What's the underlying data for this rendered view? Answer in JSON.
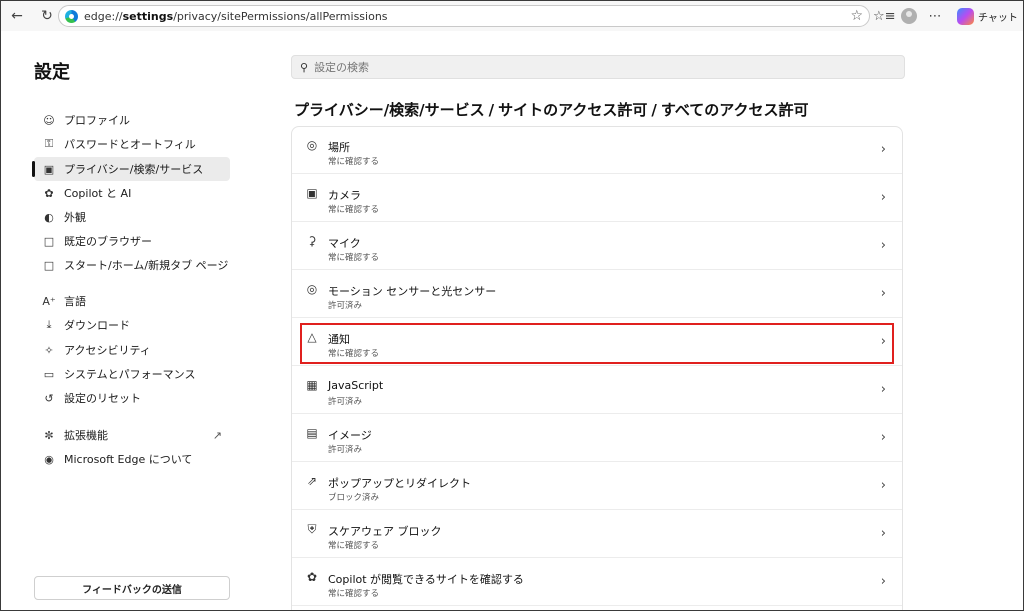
{
  "browser": {
    "url_prefix": "edge://",
    "url_host": "settings",
    "url_path": "/privacy/sitePermissions/allPermissions",
    "chat_label": "チャット"
  },
  "nav": {
    "title": "設定",
    "items": [
      {
        "label": "プロファイル",
        "icon": "profile-icon"
      },
      {
        "label": "パスワードとオートフィル",
        "icon": "key-icon"
      },
      {
        "label": "プライバシー/検索/サービス",
        "icon": "lock-icon"
      },
      {
        "label": "Copilot と AI",
        "icon": "copilot-icon"
      },
      {
        "label": "外観",
        "icon": "palette-icon"
      },
      {
        "label": "既定のブラウザー",
        "icon": "browser-icon"
      },
      {
        "label": "スタート/ホーム/新規タブ ページ",
        "icon": "home-icon"
      },
      {
        "label": "言語",
        "icon": "language-icon"
      },
      {
        "label": "ダウンロード",
        "icon": "download-icon"
      },
      {
        "label": "アクセシビリティ",
        "icon": "accessibility-icon"
      },
      {
        "label": "システムとパフォーマンス",
        "icon": "laptop-icon"
      },
      {
        "label": "設定のリセット",
        "icon": "reset-icon"
      },
      {
        "label": "拡張機能",
        "icon": "extensions-icon"
      },
      {
        "label": "Microsoft Edge について",
        "icon": "edge-icon"
      }
    ],
    "feedback_label": "フィードバックの送信"
  },
  "search": {
    "placeholder": "設定の検索"
  },
  "breadcrumb": {
    "parts": [
      "プライバシー/検索/サービス",
      "サイトのアクセス許可",
      "すべてのアクセス許可"
    ],
    "separator": "/"
  },
  "permissions": [
    {
      "title": "場所",
      "status": "常に確認する",
      "icon": "location-icon"
    },
    {
      "title": "カメラ",
      "status": "常に確認する",
      "icon": "camera-icon"
    },
    {
      "title": "マイク",
      "status": "常に確認する",
      "icon": "microphone-icon"
    },
    {
      "title": "モーション センサーと光センサー",
      "status": "許可済み",
      "icon": "sensor-icon"
    },
    {
      "title": "通知",
      "status": "常に確認する",
      "icon": "bell-icon"
    },
    {
      "title": "JavaScript",
      "status": "許可済み",
      "icon": "javascript-icon"
    },
    {
      "title": "イメージ",
      "status": "許可済み",
      "icon": "image-icon"
    },
    {
      "title": "ポップアップとリダイレクト",
      "status": "ブロック済み",
      "icon": "popup-icon"
    },
    {
      "title": "スケアウェア ブロック",
      "status": "常に確認する",
      "icon": "shield-icon"
    },
    {
      "title": "Copilot が閲覧できるサイトを確認する",
      "status": "常に確認する",
      "icon": "copilot-icon"
    }
  ],
  "colors": {
    "highlight": "#e0201e",
    "active_nav_bg": "#ebebeb"
  }
}
